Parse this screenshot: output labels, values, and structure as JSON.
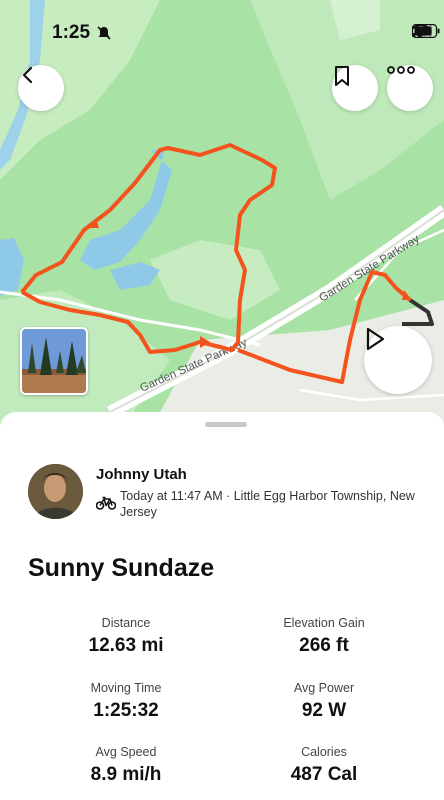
{
  "status_bar": {
    "time": "1:25"
  },
  "map": {
    "road_label_1": "Garden State Parkway",
    "road_label_2": "Garden State Parkway",
    "route_color": "#f4531e"
  },
  "athlete": {
    "name": "Johnny Utah",
    "activity_meta": "Today at 11:47 AM · Little Egg Harbor Township, New Jersey"
  },
  "activity": {
    "title": "Sunny Sundaze"
  },
  "stats": [
    {
      "label": "Distance",
      "value": "12.63 mi"
    },
    {
      "label": "Elevation Gain",
      "value": "266 ft"
    },
    {
      "label": "Moving Time",
      "value": "1:25:32"
    },
    {
      "label": "Avg Power",
      "value": "92 W"
    },
    {
      "label": "Avg Speed",
      "value": "8.9 mi/h"
    },
    {
      "label": "Calories",
      "value": "487 Cal"
    }
  ]
}
